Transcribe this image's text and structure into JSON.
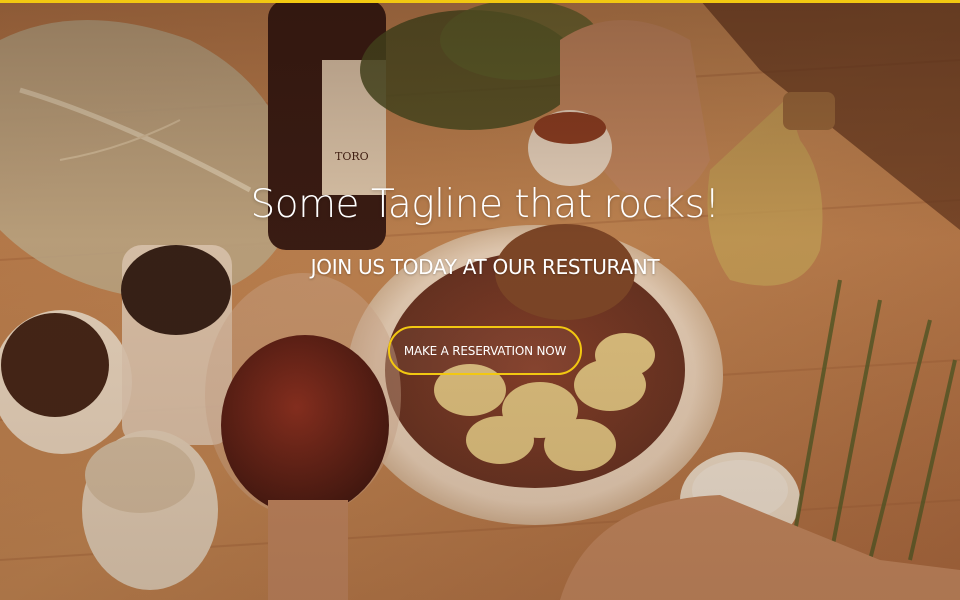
{
  "hero": {
    "tagline": "Some Tagline that rocks!",
    "subline": "JOIN US TODAY AT OUR RESTURANT",
    "cta_label": "MAKE A RESERVATION NOW"
  },
  "colors": {
    "accent": "#f2c811",
    "text": "#ffffff",
    "overlay_tint": "#9a5a32"
  }
}
